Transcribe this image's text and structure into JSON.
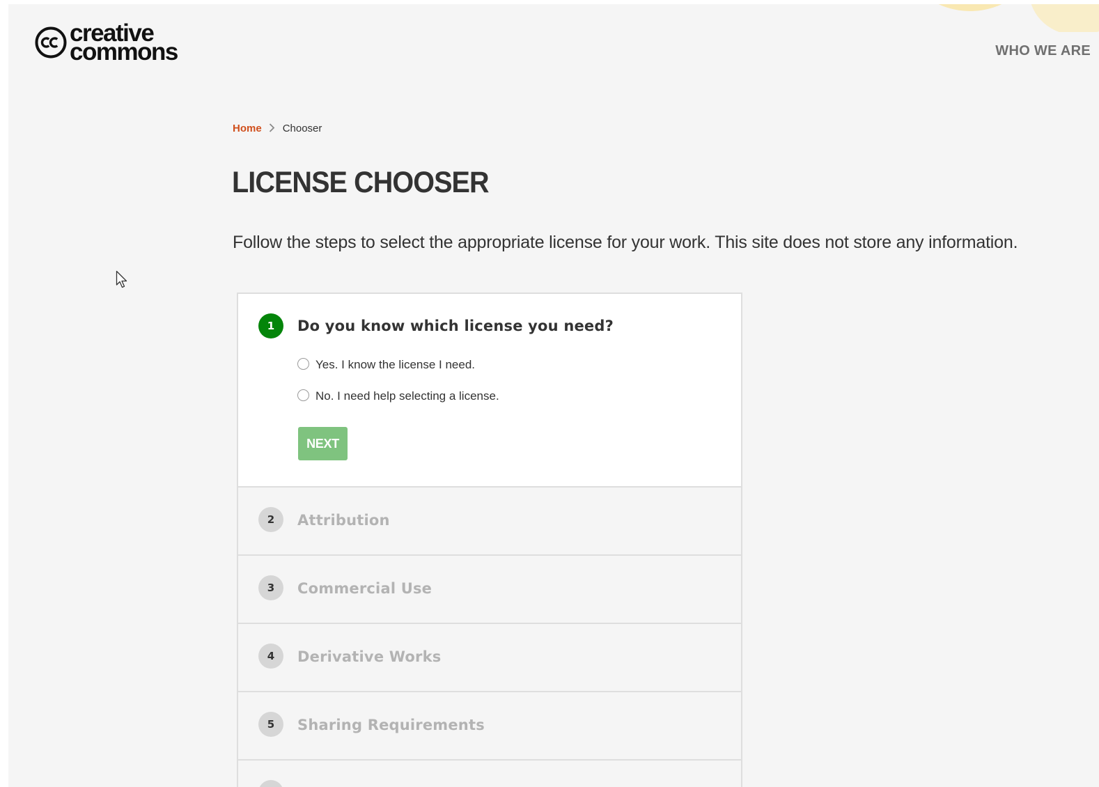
{
  "header": {
    "logo_line1": "creative",
    "logo_line2": "commons",
    "nav_who_we_are": "WHO WE ARE"
  },
  "breadcrumb": {
    "home": "Home",
    "current": "Chooser"
  },
  "main": {
    "title": "LICENSE CHOOSER",
    "description": "Follow the steps to select the appropriate license for your work. This site does not store any information."
  },
  "steps": [
    {
      "number": "1",
      "title": "Do you know which license you need?",
      "state": "active",
      "options": [
        "Yes. I know the license I need.",
        "No. I need help selecting a license."
      ],
      "next_label": "NEXT"
    },
    {
      "number": "2",
      "title": "Attribution",
      "state": "collapsed"
    },
    {
      "number": "3",
      "title": "Commercial Use",
      "state": "collapsed"
    },
    {
      "number": "4",
      "title": "Derivative Works",
      "state": "collapsed"
    },
    {
      "number": "5",
      "title": "Sharing Requirements",
      "state": "collapsed"
    }
  ],
  "colors": {
    "active_badge": "#04850a",
    "next_button": "#7fc37f",
    "breadcrumb_link": "#d04f1c",
    "inactive_title": "#b3b3b3"
  }
}
